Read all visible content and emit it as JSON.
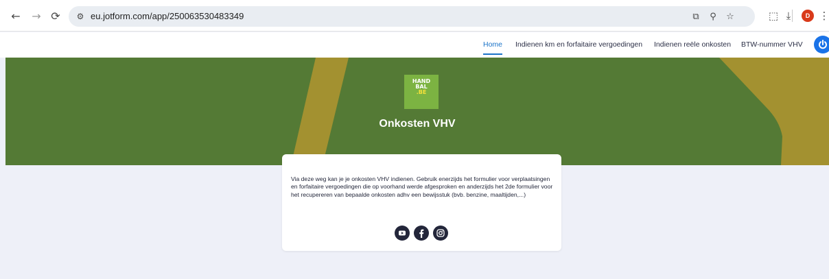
{
  "browser": {
    "url": "eu.jotform.com/app/250063530483349",
    "profile_initial": "D"
  },
  "nav": {
    "links": [
      {
        "label": "Home",
        "active": true
      },
      {
        "label": "Indienen km en forfaitaire vergoedingen",
        "active": false
      },
      {
        "label": "Indienen reële onkosten",
        "active": false
      },
      {
        "label": "BTW-nummer VHV",
        "active": false
      }
    ],
    "accent_color": "#1a73c8"
  },
  "hero": {
    "logo_lines": [
      "HAND",
      "BAL",
      ".BE"
    ],
    "title": "Onkosten VHV",
    "bg_color": "#547a35",
    "stripe_color": "#a39130"
  },
  "card": {
    "description": "Via deze weg kan je je onkosten VHV indienen. Gebruik enerzijds het formulier voor verplaatsingen en forfaitaire vergoedingen die op voorhand werde afgesproken en anderzijds het 2de formulier voor het recupereren van bepaalde onkosten adhv een bewijsstuk (bvb. benzine, maaltijden,...)",
    "socials": [
      "youtube-icon",
      "facebook-icon",
      "instagram-icon"
    ]
  }
}
